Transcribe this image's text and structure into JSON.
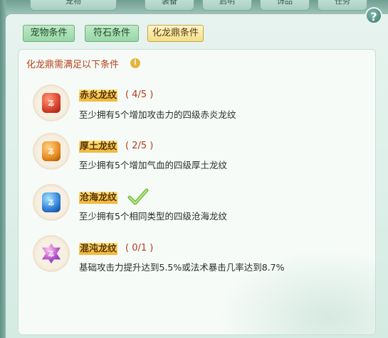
{
  "header": {
    "tabs": [
      "宠物",
      "装备",
      "启明",
      "饰品",
      "任务"
    ]
  },
  "help_symbol": "?",
  "subtabs": [
    {
      "label": "宠物条件",
      "active": false
    },
    {
      "label": "符石条件",
      "active": false
    },
    {
      "label": "化龙鼎条件",
      "active": true
    }
  ],
  "section": {
    "title": "化龙鼎需满足以下条件",
    "info_symbol": "i"
  },
  "conditions": [
    {
      "name": "赤炎龙纹",
      "progress": "( 4/5 )",
      "desc": "至少拥有5个增加攻击力的四级赤炎龙纹",
      "gem_color": "#d8402a",
      "completed": false
    },
    {
      "name": "厚土龙纹",
      "progress": "( 2/5 )",
      "desc": "至少拥有5个增加气血的四级厚土龙纹",
      "gem_color": "#e88a1c",
      "completed": false
    },
    {
      "name": "沧海龙纹",
      "progress": "",
      "desc": "至少拥有5个相同类型的四级沧海龙纹",
      "gem_color": "#2f7fd6",
      "completed": true
    },
    {
      "name": "混沌龙纹",
      "progress": "( 0/1 )",
      "desc": "基础攻击力提升达到5.5%或法术暴击几率达到8.7%",
      "gem_color": "#b24fc9",
      "completed": false
    }
  ],
  "colors": {
    "accent_title": "#b8401a",
    "check_green": "#7bc043"
  },
  "icons": {
    "check": "check-icon",
    "help": "question-icon",
    "info": "info-icon"
  }
}
